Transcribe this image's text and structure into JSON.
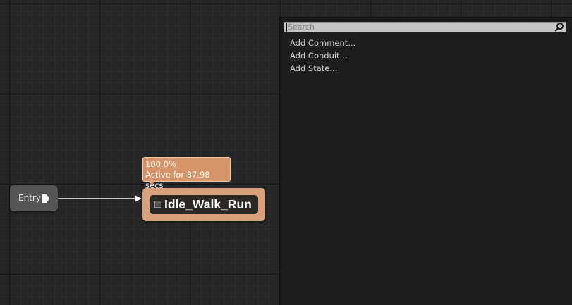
{
  "graph": {
    "entry_node": {
      "label": "Entry"
    },
    "state_node": {
      "title": "Idle_Walk_Run",
      "tooltip": {
        "weight": "100.0%",
        "active_time": "Active for 87.98 secs"
      }
    }
  },
  "context_menu": {
    "search": {
      "placeholder": "Search",
      "value": ""
    },
    "items": [
      {
        "label": "Add Comment..."
      },
      {
        "label": "Add Conduit..."
      },
      {
        "label": "Add State..."
      }
    ]
  },
  "icons": {
    "entry_pin": "exec-pin-icon",
    "state": "state-machine-icon",
    "search": "magnifier-icon"
  },
  "colors": {
    "state_node": "#d9a07c",
    "tooltip": "#d6946a",
    "entry_node": "#565656",
    "wire": "#ffffff"
  }
}
